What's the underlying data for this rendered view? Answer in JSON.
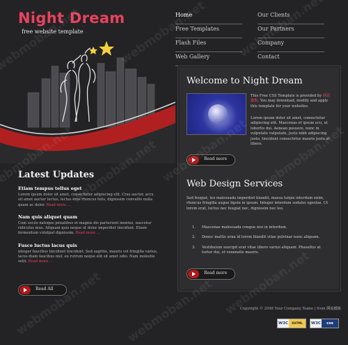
{
  "header": {
    "logo": "Night Dream",
    "tagline": "free website template"
  },
  "nav": {
    "items": [
      {
        "label": "Home",
        "active": true
      },
      {
        "label": "Our Clients"
      },
      {
        "label": "Free Templates"
      },
      {
        "label": "Our Partners"
      },
      {
        "label": "Flash Files"
      },
      {
        "label": "Company"
      },
      {
        "label": "Web Gallery"
      },
      {
        "label": "Contact"
      }
    ]
  },
  "sidebar": {
    "title": "Latest Updates",
    "items": [
      {
        "title": "Etiam tempus tellus eget",
        "body": "Lorem ipsum dolor sit amet, consectetur adipiscing elit. Cras auctor, arcu sit amet auctor luctus, lectus eros rhoncus felis, dignissim convallis nulla quam ac dolor.",
        "more": "Read more ..."
      },
      {
        "title": "Nam quis aliquet quam",
        "body": "Cum sociis natoque penatibus et magnis dis parturient montes, nascetur ridiculus mus. Aliquam quis neque ut dolor imperdiet tincidunt. Etiam fermentum volutpat dignissim.",
        "more": "Read more ..."
      },
      {
        "title": "Fusce luctus lacus quis",
        "body": "integer faucibus tincidunt tincidunt. Sed sagittis, mauris vel fringilla varius, lacus diam faucibus nisl, eu rutrum neque elit sit amet odio. Nam molestie velit.",
        "more": "Read more ..."
      }
    ],
    "button_label": "Read All"
  },
  "content": {
    "welcome_title": "Welcome to Night Dream",
    "intro_pre": "This Free CSS Template is provided by",
    "intro_site": "网页模板",
    "intro_post": ". You may download, modify and apply this template for your websites.",
    "para2": "Lorem ipsum dolor sit amet, consectetur adipiscing elit. Maecenas et ipsum ecu, ut lobortis dui. Aenean posuere, nunc in vulputate vulputate, justo nibh adipiscing justo, tincidunt consectetur mauris justo at libero.",
    "read_more_1": "Read more",
    "services_title": "Web Design Services",
    "services_intro": "Sed feugiat, leo malesuada imperdiet blandit, massa turpis interdum enim, rhoncus fringilla augue ligula in ipsum. Integer interdum sodales egestas. Ut lorem erat, luctus nec feugiat nec, dignissim nec leo.",
    "list": [
      "Maecenas malesuada congue nisi in interdum.",
      "Donec mattis urna id lorem blandit vitae pulvinar nunc aliquam.",
      "Vestibulum suscipit erat vitae libero varius aliquam. Phasellus at tortor dui, et venenatis mauris."
    ],
    "read_more_2": "Read more"
  },
  "footer": {
    "copyright": "Copyright © 2048",
    "company": "Your Company Name",
    "separator": "|",
    "from": "from",
    "site": "网站模板",
    "badge_xhtml_w3c": "W3C",
    "badge_xhtml": "XHTML 1.0",
    "badge_css_w3c": "W3C",
    "badge_css": "css"
  },
  "watermark": "webmoban.net",
  "colors": {
    "accent": "#e8425e",
    "background": "#232325",
    "panel": "#2e2e30",
    "button_red": "#b01a1a"
  }
}
